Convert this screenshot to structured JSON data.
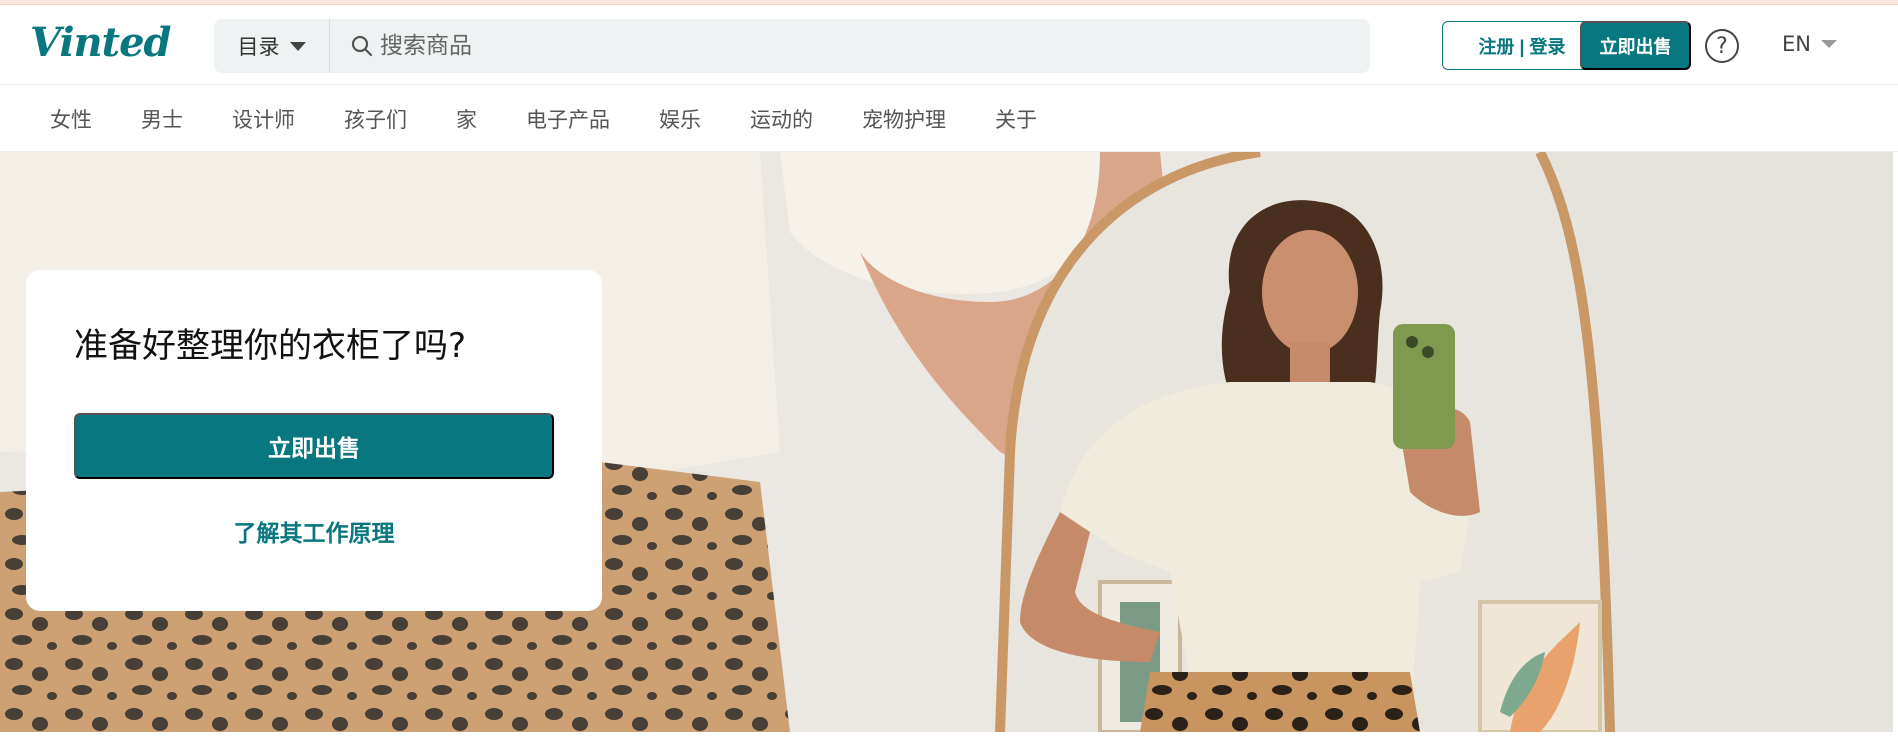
{
  "brand": {
    "logo_text": "Vinted",
    "accent_color": "#09777f"
  },
  "search": {
    "catalog_label": "目录",
    "placeholder": "搜索商品",
    "value": ""
  },
  "header": {
    "login_label": "注册 | 登录",
    "sell_label": "立即出售",
    "help_icon": "question-circle-icon",
    "language": "EN"
  },
  "categories": [
    "女性",
    "男士",
    "设计师",
    "孩子们",
    "家",
    "电子产品",
    "娱乐",
    "运动的",
    "宠物护理",
    "关于"
  ],
  "hero": {
    "title": "准备好整理你的衣柜了吗?",
    "cta_label": "立即出售",
    "link_label": "了解其工作原理"
  }
}
